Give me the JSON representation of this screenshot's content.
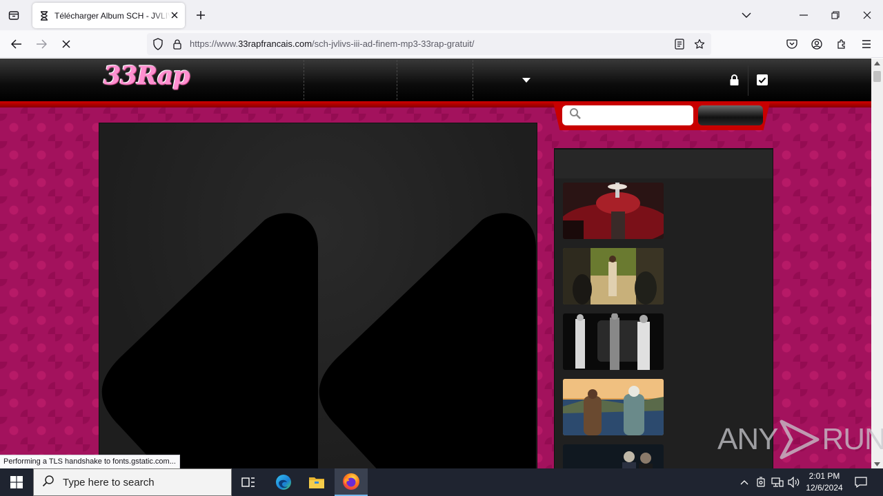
{
  "browser": {
    "tab_title": "Télécharger Album SCH - JVLIVS III",
    "url_prefix": "https://www.",
    "url_host": "33rapfrancais.com",
    "url_path": "/sch-jvlivs-iii-ad-finem-mp3-33rap-gratuit/",
    "status_text": "Performing a TLS handshake to fonts.gstatic.com..."
  },
  "site": {
    "logo_text": "33Rap",
    "search_placeholder": "",
    "accent_color": "#c80000",
    "background_color": "#a3125d"
  },
  "sidebar": {
    "thumbnails": [
      {
        "name": "thumb-1",
        "colors": [
          "#2a1414",
          "#9a1c24",
          "#e8e0d8"
        ]
      },
      {
        "name": "thumb-2",
        "colors": [
          "#5c6a2a",
          "#c8b07a",
          "#3a3020"
        ]
      },
      {
        "name": "thumb-3",
        "colors": [
          "#0a0a0a",
          "#d8d8d8",
          "#3a3a3a"
        ]
      },
      {
        "name": "thumb-4",
        "colors": [
          "#2c4a6e",
          "#e0a050",
          "#5a6a4a"
        ]
      },
      {
        "name": "thumb-5",
        "colors": [
          "#101820",
          "#c0b8a8",
          "#2a3040"
        ]
      }
    ]
  },
  "watermark": {
    "left": "ANY",
    "right": "RUN"
  },
  "taskbar": {
    "search_placeholder": "Type here to search",
    "time": "2:01 PM",
    "date": "12/6/2024"
  }
}
